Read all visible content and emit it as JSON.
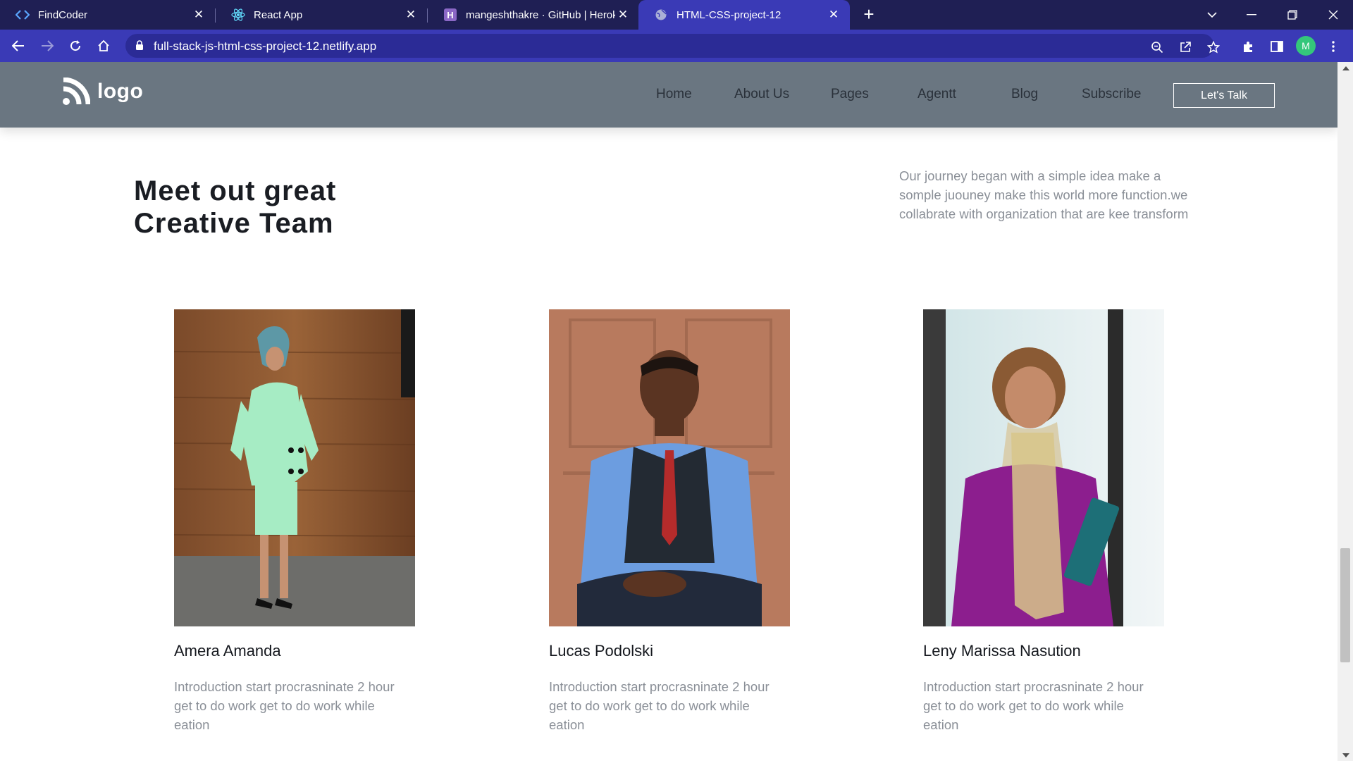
{
  "browser": {
    "tabs": [
      {
        "title": "FindCoder",
        "icon": "code-brackets-icon"
      },
      {
        "title": "React App",
        "icon": "react-icon"
      },
      {
        "title": "mangeshthakre · GitHub | Heroku",
        "icon": "heroku-icon"
      },
      {
        "title": "HTML-CSS-project-12",
        "icon": "globe-icon",
        "active": true
      }
    ],
    "url": "full-stack-js-html-css-project-12.netlify.app",
    "avatar_initial": "M",
    "colors": {
      "tabbar": "#1f1f54",
      "active_tab": "#3a3ab6",
      "omnibox": "#2b2b96"
    }
  },
  "site": {
    "logo_text": "logo",
    "nav": [
      "Home",
      "About Us",
      "Pages",
      "Agentt",
      "Blog",
      "Subscribe"
    ],
    "cta_label": "Let's Talk",
    "header_color": "#6a7681"
  },
  "team": {
    "title_line1": "Meet out great",
    "title_line2": "Creative Team",
    "intro": "Our journey began with a simple idea make a somple juouney make this world more function.we collabrate with organization that are kee transform",
    "members": [
      {
        "name": "Amera Amanda",
        "description": "Introduction start procrasninate 2 hour get to do work get to do work while eation"
      },
      {
        "name": "Lucas Podolski",
        "description": "Introduction start procrasninate 2 hour get to do work get to do work while eation"
      },
      {
        "name": "Leny Marissa Nasution",
        "description": "Introduction start procrasninate 2 hour get to do work get to do work while eation"
      }
    ]
  }
}
